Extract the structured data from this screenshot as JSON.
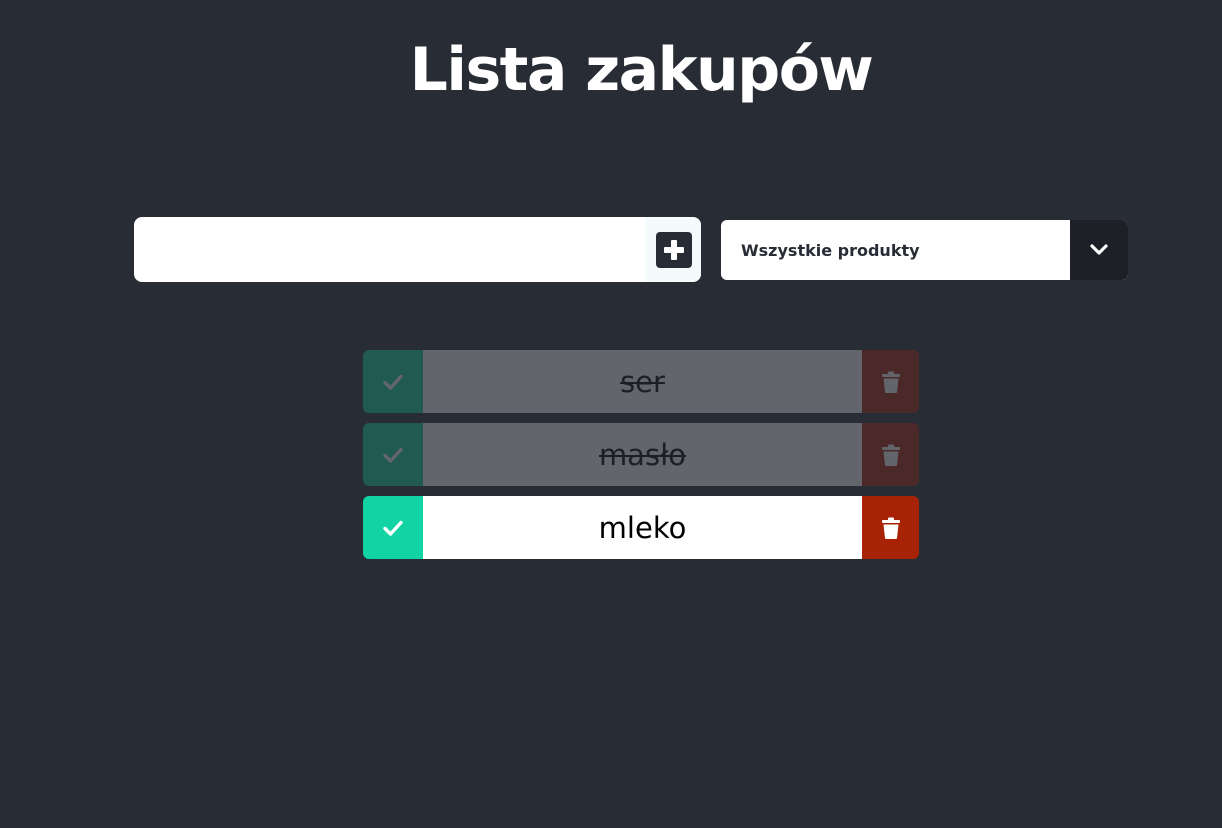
{
  "header": {
    "title": "Lista zakupów"
  },
  "add_form": {
    "input_value": "",
    "input_placeholder": "",
    "add_icon": "plus-square-icon"
  },
  "filter": {
    "selected": "Wszystkie produkty",
    "arrow_icon": "chevron-down-icon"
  },
  "todos": [
    {
      "text": "ser",
      "completed": true
    },
    {
      "text": "masło",
      "completed": true
    },
    {
      "text": "mleko",
      "completed": false
    }
  ],
  "icons": {
    "complete": "check-icon",
    "delete": "trash-icon"
  },
  "colors": {
    "background": "#282c35",
    "complete_button": "#11d3a3",
    "delete_button": "#a82306",
    "item_background": "#ffffff",
    "filter_arrow_background": "#1d2026"
  }
}
